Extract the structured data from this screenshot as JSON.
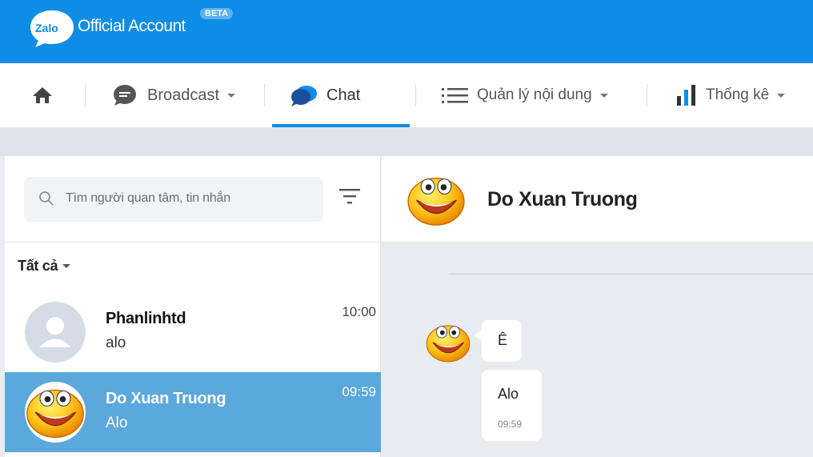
{
  "header": {
    "brand_logo": "Zalo",
    "brand_title": "Official Account",
    "beta_badge": "BETA",
    "color": "#0f8de6"
  },
  "nav": {
    "home_icon": "home-icon",
    "items": [
      {
        "label": "Broadcast",
        "icon": "speech-bubble-icon",
        "has_dropdown": true
      },
      {
        "label": "Chat",
        "icon": "chat-bubbles-icon",
        "active": true
      },
      {
        "label": "Quản lý nội dung",
        "icon": "list-icon",
        "has_dropdown": true
      },
      {
        "label": "Thống kê",
        "icon": "bar-chart-icon",
        "has_dropdown": true
      }
    ]
  },
  "sidebar": {
    "search_placeholder": "Tìm người quan tâm, tin nhắn",
    "filter_label": "Tất cả",
    "conversations": [
      {
        "name": "Phanlinhtd",
        "last_message": "alo",
        "time": "10:00",
        "avatar": "default-avatar-icon"
      },
      {
        "name": "Do Xuan Truong",
        "last_message": "Alo",
        "time": "09:59",
        "avatar": "smiley-avatar",
        "active": true
      }
    ]
  },
  "chat": {
    "contact_name": "Do Xuan Truong",
    "messages": [
      {
        "text": "Ê"
      },
      {
        "text": "Alo",
        "time": "09:59"
      }
    ]
  }
}
